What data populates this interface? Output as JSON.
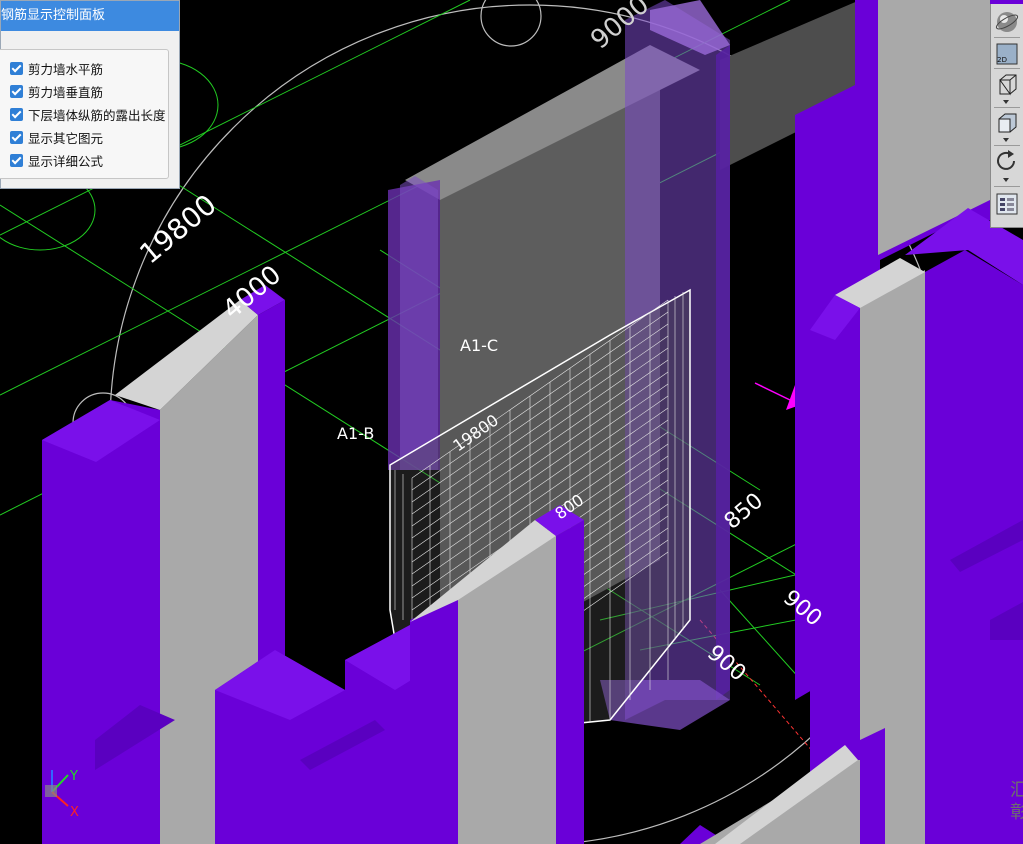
{
  "panel": {
    "title": "钢筋显示控制面板",
    "checkboxes": [
      {
        "label": "剪力墙水平筋",
        "checked": true
      },
      {
        "label": "剪力墙垂直筋",
        "checked": true
      },
      {
        "label": "下层墙体纵筋的露出长度",
        "checked": true
      },
      {
        "label": "显示其它图元",
        "checked": true
      },
      {
        "label": "显示详细公式",
        "checked": true
      }
    ]
  },
  "toolbar": {
    "buttons": [
      {
        "icon": "orbit-sphere-icon"
      },
      {
        "icon": "view-2d-icon",
        "label": "2D"
      },
      {
        "icon": "wireframe-cube-icon"
      },
      {
        "icon": "solid-cube-icon"
      },
      {
        "icon": "rotate-icon"
      },
      {
        "icon": "layer-list-icon"
      }
    ]
  },
  "scene": {
    "axis_labels": [
      "A1-B",
      "A1-C"
    ],
    "dimensions": [
      "9000",
      "19800",
      "4000",
      "19800",
      "800",
      "850",
      "900",
      "900"
    ],
    "axis_triad": {
      "y": "Y",
      "x": "X"
    },
    "edge_text": [
      "汇",
      "彰"
    ],
    "colors": {
      "background": "#000000",
      "wall_purple": "#6a00d8",
      "wall_gray": "#a9a9a9",
      "wall_light": "#d4d4d4",
      "grid_green": "#22cc22",
      "rebar_white": "#ffffff",
      "magenta": "#ff00ff"
    }
  }
}
